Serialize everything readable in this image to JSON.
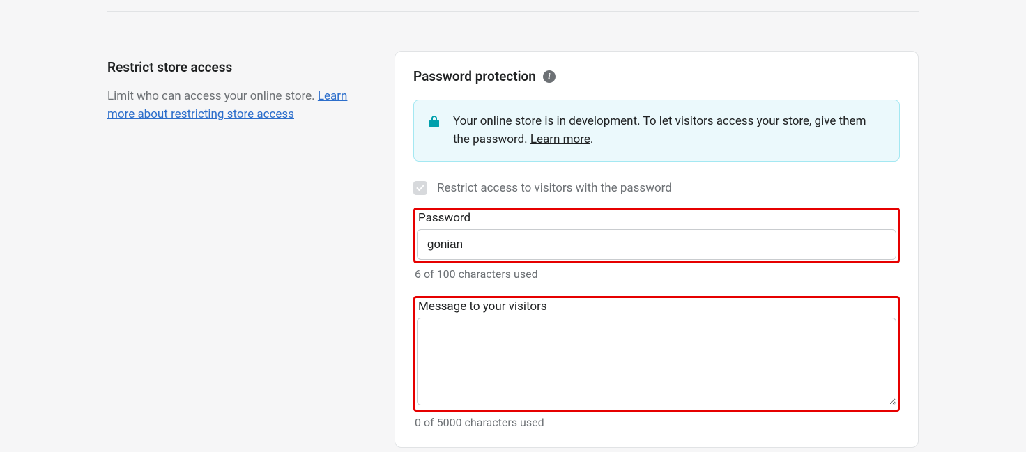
{
  "side": {
    "title": "Restrict store access",
    "desc_prefix": "Limit who can access your online store. ",
    "desc_link": "Learn more about restricting store access"
  },
  "card": {
    "title": "Password protection",
    "banner_text": "Your online store is in development. To let visitors access your store, give them the password. ",
    "banner_link": "Learn more",
    "checkbox_label": "Restrict access to visitors with the password",
    "password": {
      "label": "Password",
      "value": "gonian",
      "help": "6 of 100 characters used"
    },
    "message": {
      "label": "Message to your visitors",
      "value": "",
      "help": "0 of 5000 characters used"
    }
  }
}
